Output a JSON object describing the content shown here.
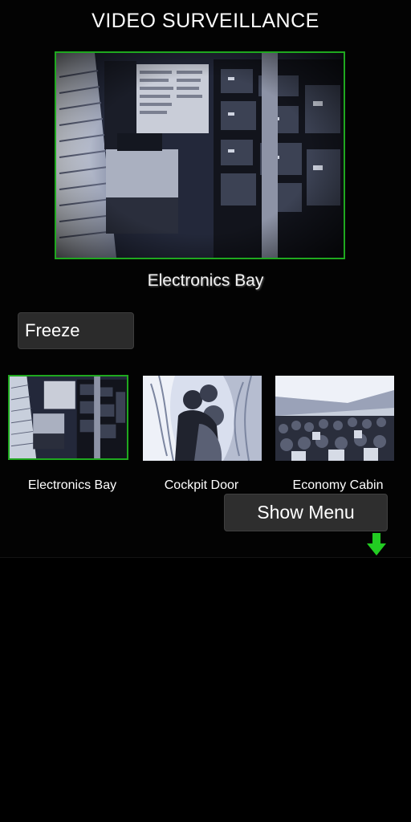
{
  "header": {
    "title": "VIDEO SURVEILLANCE"
  },
  "main_view": {
    "caption": "Electronics Bay",
    "selected_camera": "Electronics Bay",
    "border_color": "#1fa81f"
  },
  "controls": {
    "freeze_label": "Freeze",
    "show_menu_label": "Show Menu"
  },
  "cameras": [
    {
      "label": "Electronics Bay",
      "selected": true
    },
    {
      "label": "Cockpit Door",
      "selected": false
    },
    {
      "label": "Economy Cabin",
      "selected": false
    }
  ],
  "icons": {
    "scroll_down": "arrow-down-icon"
  },
  "colors": {
    "accent": "#1fa81f",
    "arrow": "#22cc22",
    "button_bg": "#2b2b2b"
  }
}
